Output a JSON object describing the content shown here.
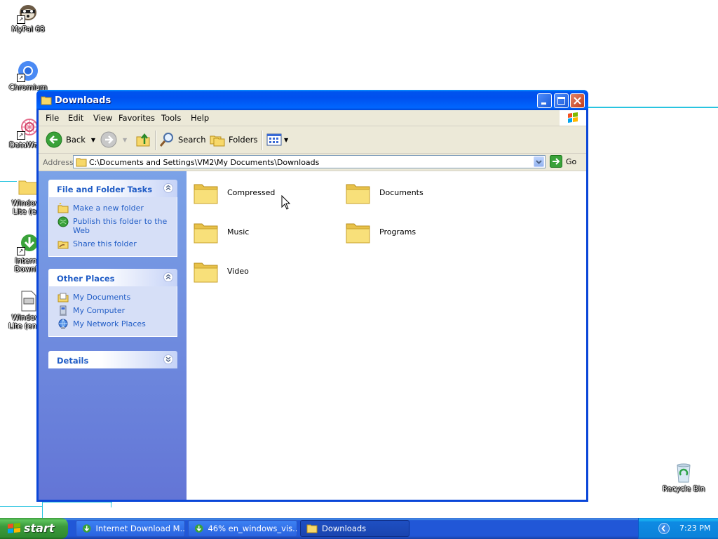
{
  "desktop": {
    "icons": [
      {
        "label": "MyPal 68"
      },
      {
        "label": "Chromium"
      },
      {
        "label": "DataWago"
      },
      {
        "label": "Windows\nLite (en-"
      },
      {
        "label": "Interne\nDownlo"
      },
      {
        "label": "Windows\nLite (en-us"
      },
      {
        "label": "Recycle Bin"
      }
    ]
  },
  "window": {
    "title": "Downloads",
    "menu": [
      "File",
      "Edit",
      "View",
      "Favorites",
      "Tools",
      "Help"
    ],
    "toolbar": {
      "back_label": "Back",
      "search_label": "Search",
      "folders_label": "Folders"
    },
    "address": {
      "label": "Address",
      "value": "C:\\Documents and Settings\\VM2\\My Documents\\Downloads",
      "go_label": "Go"
    },
    "taskpane": {
      "file_tasks": {
        "title": "File and Folder Tasks",
        "items": [
          "Make a new folder",
          "Publish this folder to the Web",
          "Share this folder"
        ]
      },
      "other_places": {
        "title": "Other Places",
        "items": [
          "My Documents",
          "My Computer",
          "My Network Places"
        ]
      },
      "details": {
        "title": "Details"
      }
    },
    "files": [
      {
        "name": "Compressed"
      },
      {
        "name": "Documents"
      },
      {
        "name": "Music"
      },
      {
        "name": "Programs"
      },
      {
        "name": "Video"
      }
    ]
  },
  "taskbar": {
    "start_label": "start",
    "buttons": [
      {
        "label": "Internet Download M..."
      },
      {
        "label": "46% en_windows_vis..."
      },
      {
        "label": "Downloads"
      }
    ],
    "clock": "7:23 PM"
  },
  "colors": {
    "titlebar": "#0054e3",
    "taskpane_link": "#215dc6",
    "start_green": "#3c9a3c",
    "desktop_line": "#29c4e0"
  }
}
